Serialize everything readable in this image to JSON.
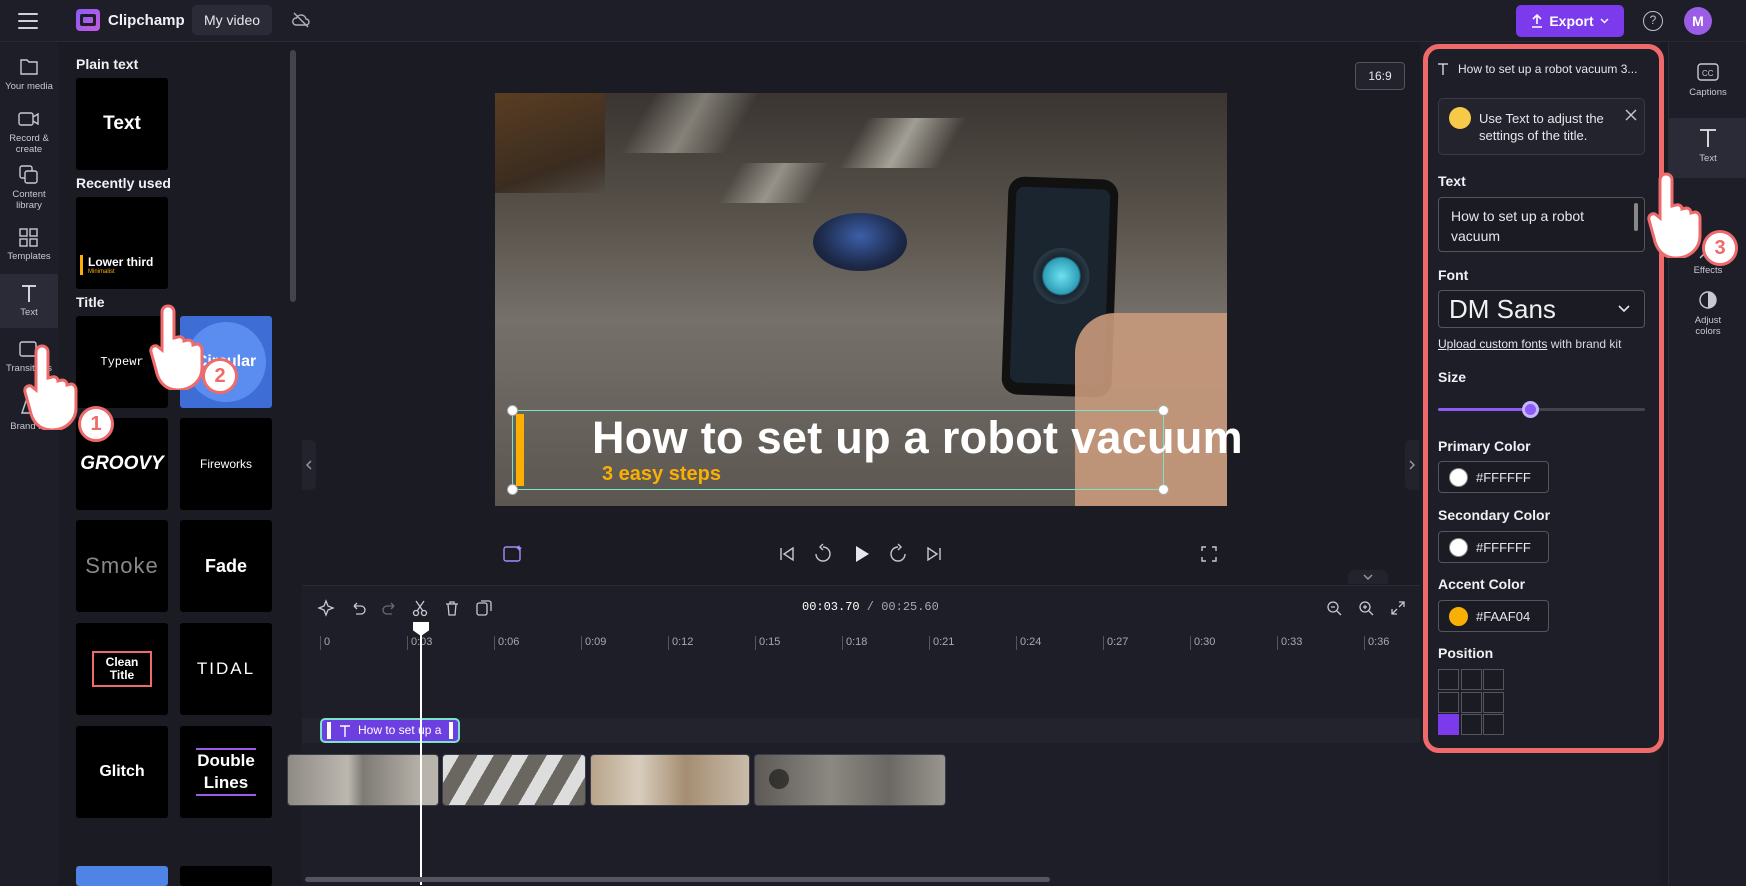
{
  "topbar": {
    "app_name": "Clipchamp",
    "project_name": "My video",
    "export_label": "Export",
    "avatar_initial": "M"
  },
  "left_rail": {
    "items": [
      {
        "label": "Your media",
        "icon": "folder-icon"
      },
      {
        "label": "Record & create",
        "icon": "camera-icon"
      },
      {
        "label": "Content library",
        "icon": "library-icon"
      },
      {
        "label": "Templates",
        "icon": "templates-icon"
      },
      {
        "label": "Text",
        "icon": "text-icon",
        "active": true
      },
      {
        "label": "Transitions",
        "icon": "transitions-icon"
      },
      {
        "label": "Brand kit",
        "icon": "brand-kit-icon"
      }
    ]
  },
  "text_panel": {
    "plain_text_heading": "Plain text",
    "plain_text_tile": "Text",
    "recently_used_heading": "Recently used",
    "recent_tile": {
      "title": "Lower third",
      "sub": "Minimalist"
    },
    "title_heading": "Title",
    "tiles": [
      "Typewr",
      "Circular",
      "GROOVY",
      "Fireworks",
      "Smoke",
      "Fade",
      "Clean Title",
      "TIDAL",
      "Glitch",
      "Double Lines"
    ]
  },
  "preview": {
    "aspect_ratio": "16:9",
    "title_text": "How to set up a robot vacuum",
    "subtitle_text": "3 easy steps"
  },
  "timeline": {
    "current_time": "00:03.70",
    "separator": " / ",
    "total_time": "00:25.60",
    "ticks": [
      "0",
      "0:03",
      "0:06",
      "0:09",
      "0:12",
      "0:15",
      "0:18",
      "0:21",
      "0:24",
      "0:27",
      "0:30",
      "0:33",
      "0:36"
    ],
    "text_clip_label": "How to set up a"
  },
  "properties": {
    "header": "How to set up a robot vacuum 3...",
    "tip": "Use Text to adjust the settings of the title.",
    "text_label": "Text",
    "text_value": "How to set up a robot vacuum",
    "font_label": "Font",
    "font_value": "DM Sans",
    "upload_link": "Upload custom fonts",
    "upload_suffix": " with brand kit",
    "size_label": "Size",
    "size_value": 0.44,
    "primary_color_label": "Primary Color",
    "primary_color": "#FFFFFF",
    "secondary_color_label": "Secondary Color",
    "secondary_color": "#FFFFFF",
    "accent_color_label": "Accent Color",
    "accent_color": "#FAAF04",
    "position_label": "Position",
    "position_selected": "bottom-left"
  },
  "right_rail": {
    "items": [
      {
        "label": "Captions",
        "icon": "captions-icon"
      },
      {
        "label": "Text",
        "icon": "text-icon",
        "active": true
      },
      {
        "label": "Effects",
        "icon": "effects-icon"
      },
      {
        "label": "Adjust colors",
        "icon": "adjust-colors-icon"
      }
    ]
  },
  "steps": [
    "1",
    "2",
    "3"
  ],
  "colors": {
    "accent": "#7c3aed",
    "highlight": "#ef6a6a",
    "title_accent": "#FAAF04"
  }
}
